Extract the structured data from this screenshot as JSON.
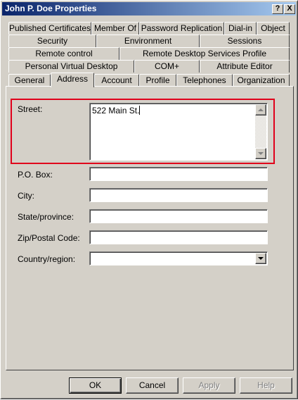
{
  "window": {
    "title": "John P. Doe Properties",
    "help_glyph": "?",
    "close_glyph": "X"
  },
  "tabs": {
    "row1": [
      "Published Certificates",
      "Member Of",
      "Password Replication",
      "Dial-in",
      "Object"
    ],
    "row2": [
      "Security",
      "Environment",
      "Sessions"
    ],
    "row3": [
      "Remote control",
      "Remote Desktop Services Profile"
    ],
    "row4": [
      "Personal Virtual Desktop",
      "COM+",
      "Attribute Editor"
    ],
    "row5": [
      "General",
      "Address",
      "Account",
      "Profile",
      "Telephones",
      "Organization"
    ],
    "active": "Address"
  },
  "form": {
    "street_label": "Street:",
    "street_value": "522 Main St.",
    "pobox_label": "P.O. Box:",
    "pobox_value": "",
    "city_label": "City:",
    "city_value": "",
    "state_label": "State/province:",
    "state_value": "",
    "zip_label": "Zip/Postal Code:",
    "zip_value": "",
    "country_label": "Country/region:",
    "country_value": ""
  },
  "buttons": {
    "ok": "OK",
    "cancel": "Cancel",
    "apply": "Apply",
    "help": "Help"
  },
  "colors": {
    "face": "#d4d0c8",
    "title_start": "#0a246a",
    "title_end": "#a6caf0",
    "highlight": "#e0001b"
  }
}
